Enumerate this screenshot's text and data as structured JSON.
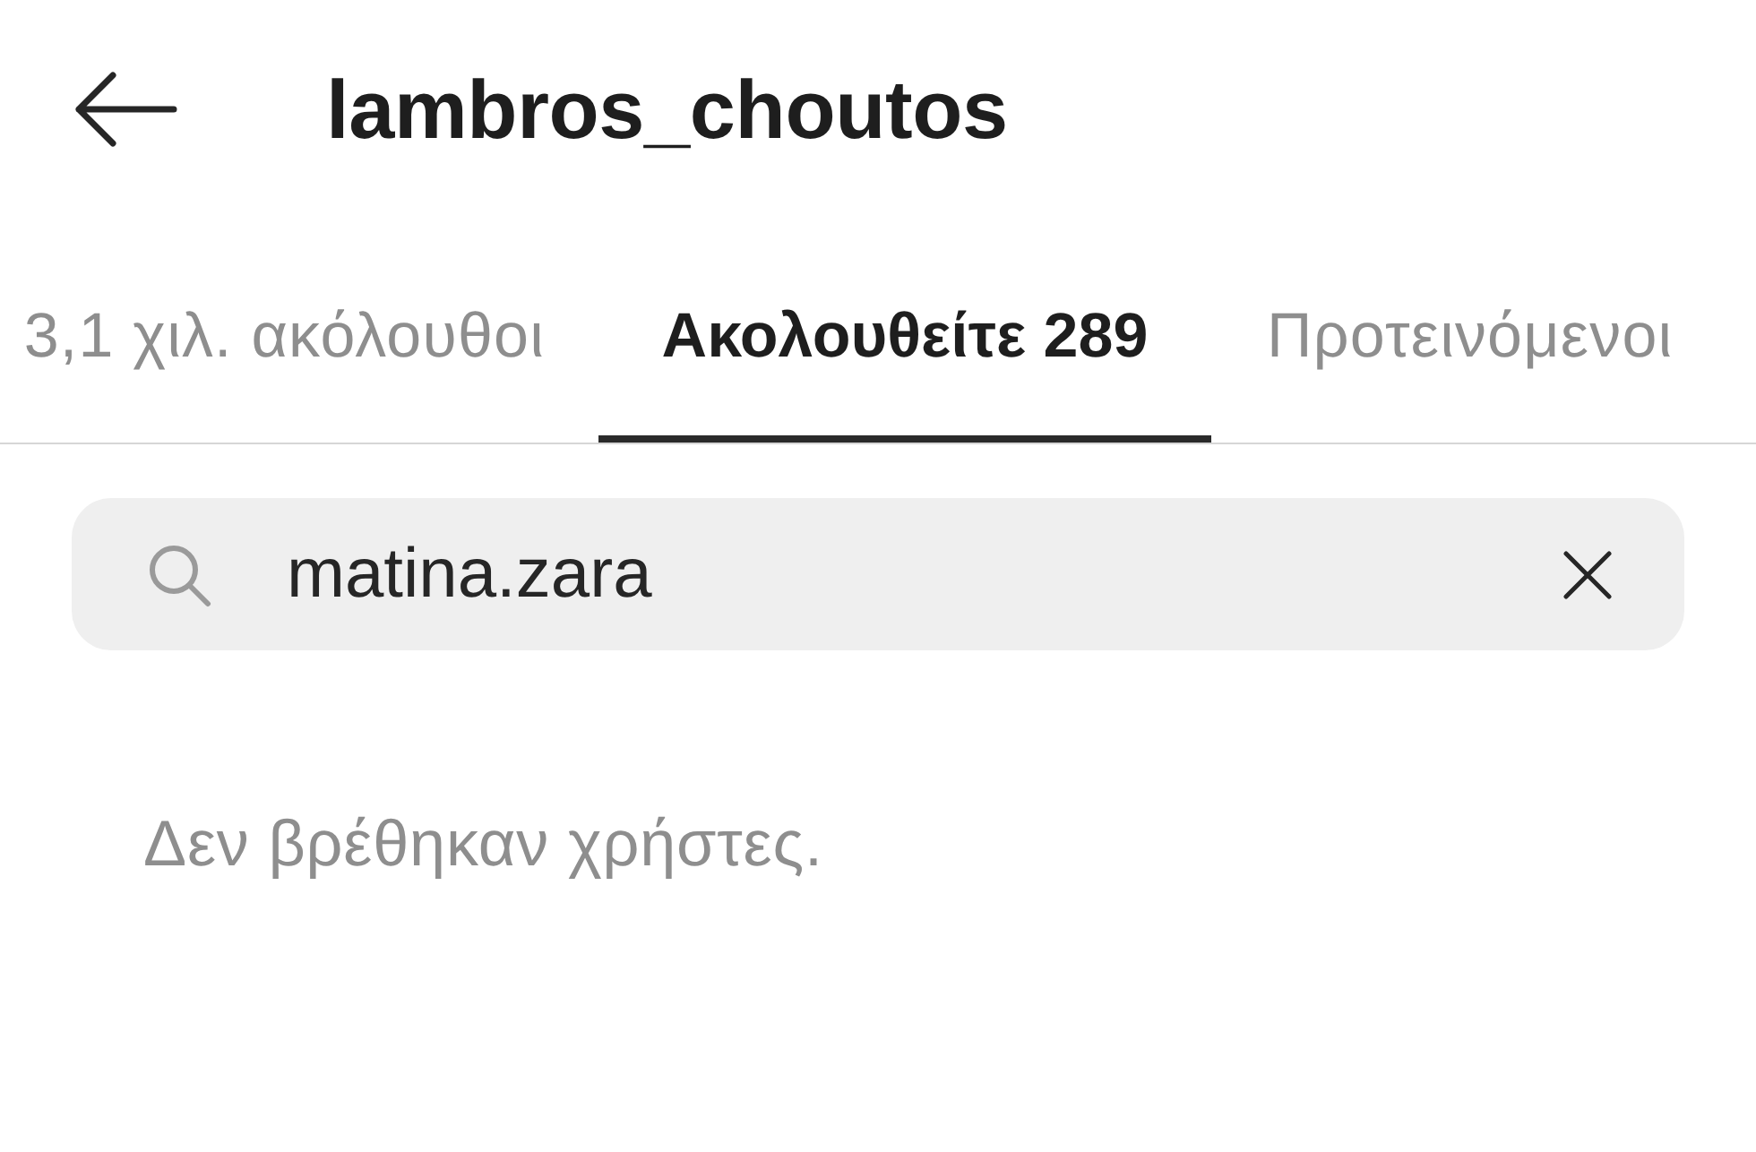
{
  "header": {
    "title": "lambros_choutos"
  },
  "tabs": [
    {
      "label": "3,1 χιλ. ακόλουθοι",
      "selected": false
    },
    {
      "label": "Ακολουθείτε 289",
      "selected": true
    },
    {
      "label": "Προτεινόμενοι",
      "selected": false
    }
  ],
  "search": {
    "value": "matina.zara"
  },
  "empty_message": "Δεν βρέθηκαν χρήστες."
}
